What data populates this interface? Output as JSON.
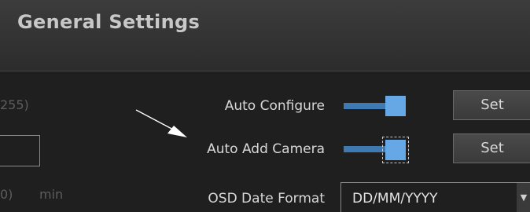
{
  "window": {
    "title": "General Settings"
  },
  "left_column": {
    "range_hint": "255)",
    "input_value": "",
    "duration_hint": "0)",
    "unit_label": "min"
  },
  "settings": {
    "auto_configure": {
      "label": "Auto Configure",
      "button_label": "Set",
      "toggle_state": "on"
    },
    "auto_add_camera": {
      "label": "Auto Add Camera",
      "button_label": "Set",
      "toggle_state": "on"
    },
    "osd_date_format": {
      "label": "OSD Date Format",
      "value": "DD/MM/YYYY"
    }
  },
  "colors": {
    "background": "#1f1f1f",
    "header": "#363636",
    "slider_track": "#3e79b2",
    "slider_thumb": "#66a7e6",
    "text": "#d8d8d8"
  },
  "icons": {
    "dropdown": "chevron-down-icon",
    "pointer": "arrow-annotation"
  }
}
